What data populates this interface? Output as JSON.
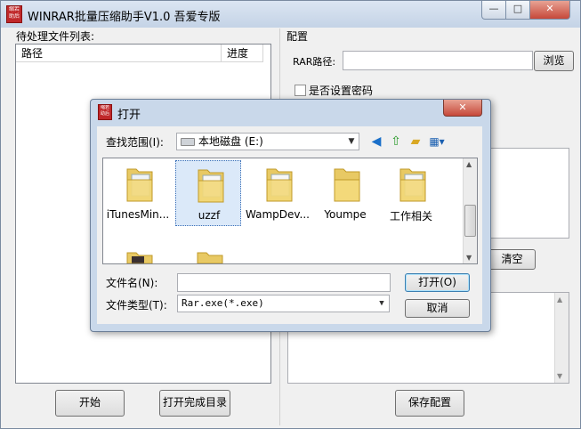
{
  "window": {
    "title": "WINRAR批量压缩助手V1.0 吾爱专版",
    "icon_text": "缩若\n助后",
    "min_glyph": "—",
    "max_glyph": "□",
    "close_glyph": "✕"
  },
  "left_panel": {
    "label": "待处理文件列表:",
    "columns": [
      "路径",
      "进度"
    ],
    "start_button": "开始",
    "open_dir_button": "打开完成目录"
  },
  "config_panel": {
    "label": "配置",
    "rar_path_label": "RAR路径:",
    "rar_path_value": "",
    "browse_button": "浏览",
    "password_checkbox_label": "是否设置密码",
    "clear_button": "清空",
    "save_button": "保存配置"
  },
  "dialog": {
    "title": "打开",
    "close_glyph": "✕",
    "look_in_label": "查找范围(I):",
    "look_in_value": "本地磁盘 (E:)",
    "files": [
      "iTunesMin...",
      "uzzf",
      "WampDev...",
      "Youmpe",
      "工作相关",
      "",
      ""
    ],
    "selected_file": "uzzf",
    "filename_label": "文件名(N):",
    "filename_value": "",
    "filetype_label": "文件类型(T):",
    "filetype_value": "Rar.exe(*.exe)",
    "open_button": "打开(O)",
    "cancel_button": "取消"
  }
}
